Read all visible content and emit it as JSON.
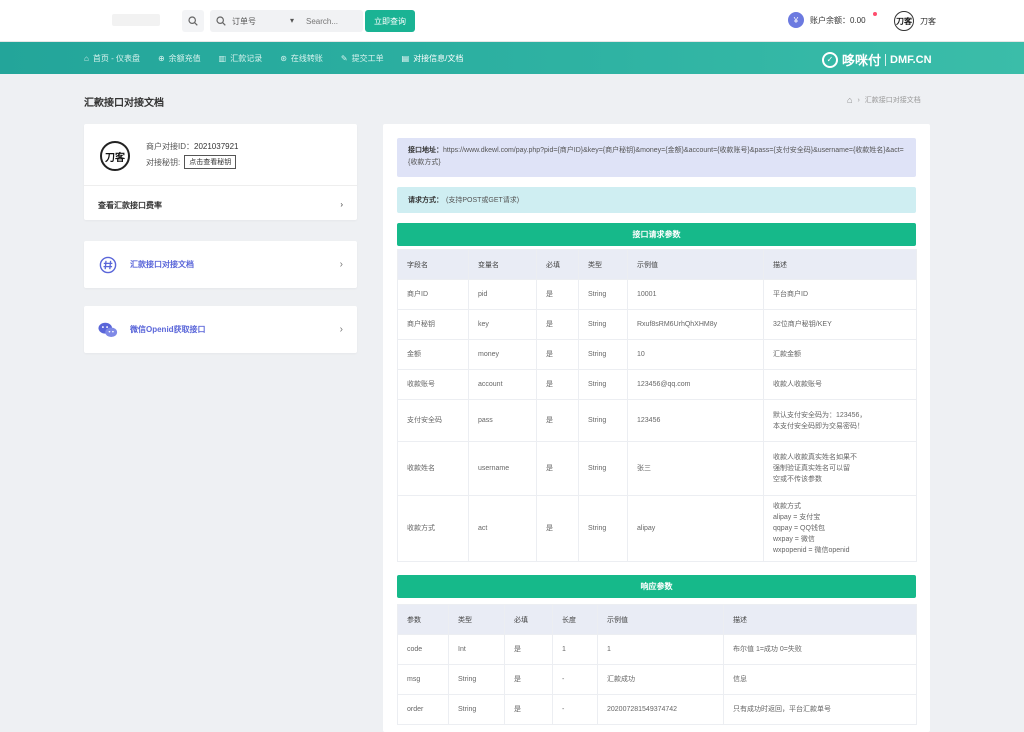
{
  "topbar": {
    "select_label": "订单号",
    "search_placeholder": "Search...",
    "query_label": "立即查询",
    "balance_label": "账户余额：",
    "balance_value": "0.00",
    "username": "刀客",
    "avatar_text": "刀客"
  },
  "nav": {
    "items": [
      {
        "label": "首页 - 仪表盘",
        "icon": "home-icon"
      },
      {
        "label": "余额充值",
        "icon": "recharge-icon"
      },
      {
        "label": "汇款记录",
        "icon": "chart-icon"
      },
      {
        "label": "在线转账",
        "icon": "transfer-icon"
      },
      {
        "label": "提交工单",
        "icon": "edit-icon"
      },
      {
        "label": "对接信息/文档",
        "icon": "document-icon"
      }
    ],
    "brand_name": "哆咪付",
    "brand_domain": "DMF.CN"
  },
  "page": {
    "title": "汇款接口对接文档",
    "breadcrumb_current": "汇款接口对接文档"
  },
  "merchant": {
    "id_label": "商户对接ID：",
    "id_value": "2021037921",
    "secret_label": "对接秘钥:",
    "secret_button": "点击查看秘钥",
    "rate_link": "查看汇款接口费率"
  },
  "links": [
    {
      "label": "汇款接口对接文档",
      "icon": "hash-icon"
    },
    {
      "label": "微信Openid获取接口",
      "icon": "wechat-icon"
    }
  ],
  "api": {
    "url_label": "接口地址：",
    "url_value": "https://www.dkewl.com/pay.php?pid={商户ID}&key={商户秘钥}&money={金额}&account={收款账号}&pass={支付安全码}&username={收款姓名}&act={收款方式}",
    "method_label": "请求方式：",
    "method_value": "(支持POST或GET请求)",
    "request_title": "接口请求参数",
    "request_headers": [
      "字段名",
      "变量名",
      "必填",
      "类型",
      "示例值",
      "描述"
    ],
    "request_rows": [
      [
        "商户ID",
        "pid",
        "是",
        "String",
        "10001",
        "平台商户ID"
      ],
      [
        "商户秘钥",
        "key",
        "是",
        "String",
        "Rxuf8sRM6UrhQhXHM8y",
        "32位商户秘钥/KEY"
      ],
      [
        "金额",
        "money",
        "是",
        "String",
        "10",
        "汇款金额"
      ],
      [
        "收款账号",
        "account",
        "是",
        "String",
        "123456@qq.com",
        "收款人收款账号"
      ],
      [
        "支付安全码",
        "pass",
        "是",
        "String",
        "123456",
        "默认支付安全码为：123456，\n本支付安全码即为交易密码！"
      ],
      [
        "收款姓名",
        "username",
        "是",
        "String",
        "张三",
        "收款人收款真实姓名如果不\n强制验证真实姓名可以留\n空或不传该参数"
      ],
      [
        "收款方式",
        "act",
        "是",
        "String",
        "alipay",
        "收款方式\nalipay = 支付宝\nqqpay = QQ钱包\nwxpay = 微信\nwxpopenid = 微信openid"
      ]
    ],
    "response_title": "响应参数",
    "response_headers": [
      "参数",
      "类型",
      "必填",
      "长度",
      "示例值",
      "描述"
    ],
    "response_rows": [
      [
        "code",
        "Int",
        "是",
        "1",
        "1",
        "布尔值 1=成功 0=失败"
      ],
      [
        "msg",
        "String",
        "是",
        "-",
        "汇款成功",
        "信息"
      ],
      [
        "order",
        "String",
        "是",
        "-",
        "202007281549374742",
        "只有成功时返回，平台汇款单号"
      ]
    ]
  }
}
